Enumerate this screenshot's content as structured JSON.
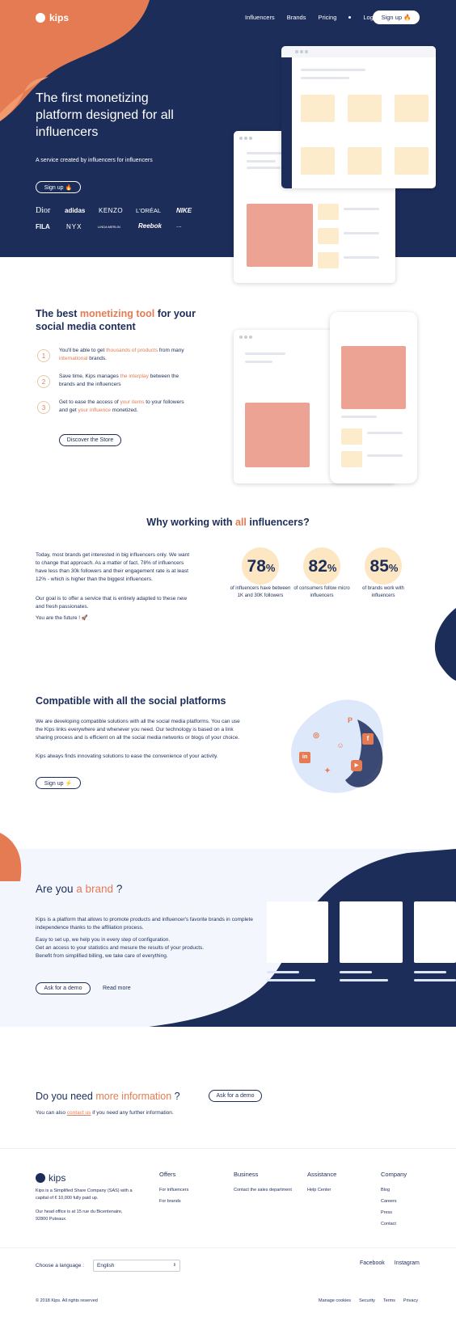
{
  "colors": {
    "navy": "#1c2d5a",
    "orange": "#e57b52",
    "peach": "#fde7c2",
    "light_bg": "#f3f7fd"
  },
  "nav": {
    "logo": "kips",
    "links": [
      "Influencers",
      "Brands",
      "Pricing"
    ],
    "login": "Login",
    "signup": "Sign up 🔥"
  },
  "hero": {
    "title": "The first monetizing platform designed for all influencers",
    "subtitle": "A service created by influencers for influencers",
    "cta": "Sign up 🔥",
    "brands": [
      "Dior",
      "adidas",
      "KENZO",
      "L'ORÉAL",
      "NIKE",
      "FILA",
      "NYX",
      "LINDA MERLIN",
      "Reebok",
      "..."
    ]
  },
  "tool": {
    "title_pre": "The best ",
    "title_hl": "monetizing tool",
    "title_post": " for your social media content",
    "steps": [
      {
        "num": "1",
        "pre": "You'll be able to get ",
        "hl": "thousands of products",
        "mid": " from many ",
        "hl2": "international",
        "post": " brands."
      },
      {
        "num": "2",
        "pre": "Save time, Kips manages ",
        "hl": "the interplay",
        "mid": " between the brands and the influencers",
        "hl2": "",
        "post": ""
      },
      {
        "num": "3",
        "pre": "Get to ease the access of ",
        "hl": "your items",
        "mid": " to your followers and get ",
        "hl2": "your influence",
        "post": " monetized."
      }
    ],
    "cta": "Discover the Store"
  },
  "why": {
    "title_pre": "Why working with ",
    "title_hl": "all",
    "title_post": " influencers?",
    "p1": "Today, most brands get interested in big influencers only. We want to change that approach. As a matter of fact, 78% of influencers have less than 30k followers and their engagement rate is at least 12% - which is higher than the biggest influencers.",
    "p2": "Our goal is to offer a service that is entirely adapted to these new and fresh passionates.",
    "p3": "You are the future ! 🚀",
    "stats": [
      {
        "value": "78",
        "unit": "%",
        "caption": "of influencers have between 1K and 30K followers"
      },
      {
        "value": "82",
        "unit": "%",
        "caption": "of consumers follow micro influencers"
      },
      {
        "value": "85",
        "unit": "%",
        "caption": "of brands work with influencers"
      }
    ]
  },
  "social": {
    "title": "Compatible with all the social platforms",
    "p1": "We are developing compatible solutions with all the social media platforms. You can use the Kips links everywhere and whenever you need. Our technology is based on a link sharing process and is efficient on all the social media networks or blogs of your choice.",
    "p2": "Kips always finds innovating solutions to ease the convenience of your activity.",
    "cta": "Sign up ⚡"
  },
  "brand": {
    "title_pre": "Are you ",
    "title_hl": "a brand",
    "title_post": " ?",
    "p1": "Kips is a platform that allows to promote products and influencer's favorite brands in complete independence thanks to the affiliation process.",
    "p2": "Easy to set up, we help you in every step of configuration.",
    "p3": "Get an access to your statistics and mesure the results of your products.",
    "p4": "Benefit from simplified billing, we take care of everything.",
    "cta": "Ask for a demo",
    "more": "Read more"
  },
  "info": {
    "title_pre": "Do you need ",
    "title_hl": "more information",
    "title_post": " ?",
    "cta": "Ask for a demo",
    "text_pre": "You can also ",
    "text_link": "contact us",
    "text_post": " if you need any further information."
  },
  "footer": {
    "logo": "kips",
    "about1": "Kips is a Simplified Share Company (SAS) with a capital of € 10,000 fully paid up.",
    "about2": "Our head office is at 15 rue du Bicentenaire, 92800 Puteaux.",
    "cols": [
      {
        "title": "Offers",
        "items": [
          "For influencers",
          "For brands"
        ]
      },
      {
        "title": "Business",
        "items": [
          "Contact the sales department"
        ]
      },
      {
        "title": "Assistance",
        "items": [
          "Help Center"
        ]
      },
      {
        "title": "Company",
        "items": [
          "Blog",
          "Careers",
          "Press",
          "Contact"
        ]
      }
    ],
    "lang_label": "Choose a language :",
    "lang_value": "English",
    "socials": [
      "Facebook",
      "Instagram"
    ],
    "copyright": "© 2018 Kips. All rights reserved",
    "legal": [
      "Manage cookies",
      "Security",
      "Terms",
      "Privacy"
    ]
  }
}
